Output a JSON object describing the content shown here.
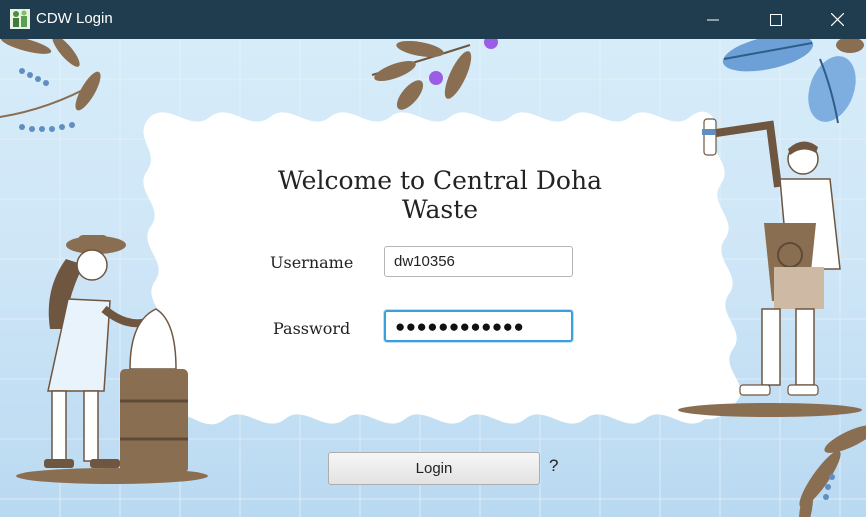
{
  "window": {
    "title": "CDW Login",
    "controls": [
      "minimize-icon",
      "maximize-icon",
      "close-icon"
    ]
  },
  "heading": "Welcome to Central Doha Waste",
  "form": {
    "username_label": "Username",
    "username_value": "dw10356",
    "password_label": "Password",
    "password_masked": "●●●●●●●●●●●●"
  },
  "login_button": "Login",
  "help_label": "?",
  "icons": [
    "app-icon",
    "minimize-icon",
    "maximize-icon",
    "close-icon"
  ],
  "colors": {
    "titlebar": "#1f3d4f",
    "background_top": "#d6ecf9",
    "background_bottom": "#b9d9f1",
    "focus_border": "#3aa0dc",
    "accent_purple": "#9b5de5",
    "leaf_brown": "#8a6e52",
    "leaf_blue": "#5f8fc2"
  }
}
